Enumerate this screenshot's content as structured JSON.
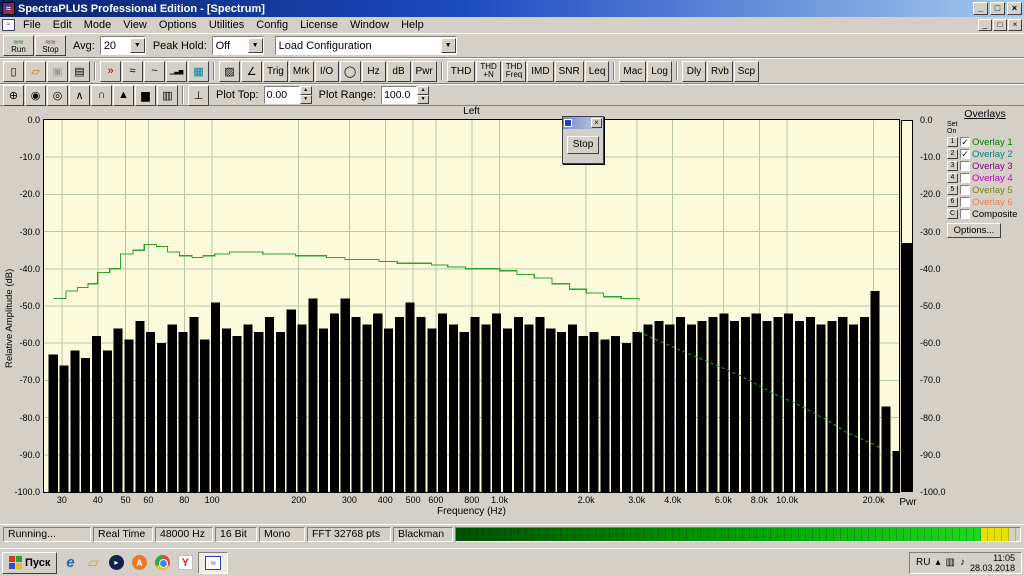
{
  "window": {
    "title": "SpectraPLUS Professional Edition - [Spectrum]",
    "minimize": "_",
    "maximize": "□",
    "close": "×"
  },
  "menu": {
    "items": [
      "File",
      "Edit",
      "Mode",
      "View",
      "Options",
      "Utilities",
      "Config",
      "License",
      "Window",
      "Help"
    ]
  },
  "toolbar1": {
    "run_label": "Run",
    "stop_label": "Stop",
    "avg_label": "Avg:",
    "avg_value": "20",
    "peak_label": "Peak Hold:",
    "peak_value": "Off",
    "config_value": "Load Configuration"
  },
  "toolbar2": {
    "items": [
      {
        "type": "icon",
        "name": "new-file",
        "glyph": "▯"
      },
      {
        "type": "icon",
        "name": "open-folder",
        "glyph": "▱",
        "color": "#b08000"
      },
      {
        "type": "icon",
        "name": "save",
        "glyph": "▣",
        "disabled": true
      },
      {
        "type": "icon",
        "name": "print",
        "glyph": "▤"
      },
      {
        "type": "sep"
      },
      {
        "type": "icon",
        "name": "fast-forward",
        "glyph": "»",
        "color": "#a00000"
      },
      {
        "type": "icon",
        "name": "time-series",
        "glyph": "≈"
      },
      {
        "type": "icon",
        "name": "waveform",
        "glyph": "~"
      },
      {
        "type": "icon",
        "name": "spectrum-bars",
        "glyph": "▁▃▅"
      },
      {
        "type": "icon",
        "name": "spectrogram",
        "glyph": "▦",
        "color": "#0080a0"
      },
      {
        "type": "sep"
      },
      {
        "type": "icon",
        "name": "surface-plot",
        "glyph": "▨"
      },
      {
        "type": "icon",
        "name": "phase",
        "glyph": "∠"
      },
      {
        "type": "text",
        "name": "trigger",
        "label": "Trig"
      },
      {
        "type": "text",
        "name": "markers",
        "label": "Mrk"
      },
      {
        "type": "text",
        "name": "io",
        "label": "I/O"
      },
      {
        "type": "icon",
        "name": "clock",
        "glyph": "◯"
      },
      {
        "type": "text",
        "name": "hz",
        "label": "Hz"
      },
      {
        "type": "text",
        "name": "db",
        "label": "dB"
      },
      {
        "type": "text",
        "name": "pwr",
        "label": "Pwr"
      },
      {
        "type": "sep"
      },
      {
        "type": "text",
        "name": "thd",
        "label": "THD"
      },
      {
        "type": "text",
        "name": "thd-n",
        "label": "THD\n+N",
        "small": true
      },
      {
        "type": "text",
        "name": "thd-freq",
        "label": "THD\nFreq",
        "small": true
      },
      {
        "type": "text",
        "name": "imd",
        "label": "IMD"
      },
      {
        "type": "text",
        "name": "snr",
        "label": "SNR"
      },
      {
        "type": "text",
        "name": "leq",
        "label": "Leq"
      },
      {
        "type": "sep"
      },
      {
        "type": "text",
        "name": "mac",
        "label": "Mac"
      },
      {
        "type": "text",
        "name": "log",
        "label": "Log"
      },
      {
        "type": "sep"
      },
      {
        "type": "text",
        "name": "dly",
        "label": "Dly"
      },
      {
        "type": "text",
        "name": "rvb",
        "label": "Rvb"
      },
      {
        "type": "text",
        "name": "scp",
        "label": "Scp"
      }
    ]
  },
  "toolbar3": {
    "items": [
      {
        "type": "icon",
        "name": "zoom",
        "glyph": "⊕"
      },
      {
        "type": "icon",
        "name": "cursor-toggle",
        "glyph": "◉"
      },
      {
        "type": "icon",
        "name": "readout-toggle",
        "glyph": "◎"
      },
      {
        "type": "icon",
        "name": "peak-display",
        "glyph": "∧"
      },
      {
        "type": "icon",
        "name": "line-plot",
        "glyph": "∩"
      },
      {
        "type": "icon",
        "name": "filled-plot",
        "glyph": "▲"
      },
      {
        "type": "icon",
        "name": "bar-plot",
        "glyph": "▆"
      },
      {
        "type": "icon",
        "name": "grid-table",
        "glyph": "▥"
      },
      {
        "type": "sep"
      },
      {
        "type": "icon",
        "name": "marker-line",
        "glyph": "⊥"
      }
    ],
    "plot_top_label": "Plot Top:",
    "plot_top_value": "0.00",
    "plot_range_label": "Plot Range:",
    "plot_range_value": "100.0"
  },
  "chart_data": {
    "type": "bar",
    "title": "Left",
    "xlabel": "Frequency (Hz)",
    "ylabel": "Relative Amplitude (dB)",
    "x_scale": "log",
    "xlim": [
      26,
      24500
    ],
    "ylim": [
      -100,
      0
    ],
    "grid": true,
    "background": "#fbfbdc",
    "grid_color": "#b9c6a4",
    "bar_color": "#000000",
    "x_ticks": [
      [
        30,
        "30"
      ],
      [
        40,
        "40"
      ],
      [
        50,
        "50"
      ],
      [
        60,
        "60"
      ],
      [
        80,
        "80"
      ],
      [
        100,
        "100"
      ],
      [
        200,
        "200"
      ],
      [
        300,
        "300"
      ],
      [
        400,
        "400"
      ],
      [
        500,
        "500"
      ],
      [
        600,
        "600"
      ],
      [
        800,
        "800"
      ],
      [
        1000,
        "1.0k"
      ],
      [
        2000,
        "2.0k"
      ],
      [
        3000,
        "3.0k"
      ],
      [
        4000,
        "4.0k"
      ],
      [
        6000,
        "6.0k"
      ],
      [
        8000,
        "8.0k"
      ],
      [
        10000,
        "10.0k"
      ],
      [
        20000,
        "20.0k"
      ]
    ],
    "y_ticks": [
      [
        0,
        "0.0"
      ],
      [
        -10,
        "-10.0"
      ],
      [
        -20,
        "-20.0"
      ],
      [
        -30,
        "-30.0"
      ],
      [
        -40,
        "-40.0"
      ],
      [
        -50,
        "-50.0"
      ],
      [
        -60,
        "-60.0"
      ],
      [
        -70,
        "-70.0"
      ],
      [
        -80,
        "-80.0"
      ],
      [
        -90,
        "-90.0"
      ],
      [
        -100,
        "-100.0"
      ]
    ],
    "bars": [
      [
        28,
        -63
      ],
      [
        30.5,
        -66
      ],
      [
        33.3,
        -62
      ],
      [
        36.3,
        -64
      ],
      [
        39.6,
        -58
      ],
      [
        43.2,
        -62
      ],
      [
        47.1,
        -56
      ],
      [
        51.4,
        -59
      ],
      [
        56,
        -54
      ],
      [
        61.1,
        -57
      ],
      [
        66.6,
        -60
      ],
      [
        72.6,
        -55
      ],
      [
        79.2,
        -57
      ],
      [
        86.4,
        -53
      ],
      [
        94.2,
        -59
      ],
      [
        102.7,
        -49
      ],
      [
        112,
        -56
      ],
      [
        122.1,
        -58
      ],
      [
        133.2,
        -55
      ],
      [
        145.2,
        -57
      ],
      [
        158.4,
        -53
      ],
      [
        172.7,
        -57
      ],
      [
        188.3,
        -51
      ],
      [
        205.4,
        -55
      ],
      [
        224,
        -48
      ],
      [
        244.2,
        -56
      ],
      [
        266.3,
        -52
      ],
      [
        290.4,
        -48
      ],
      [
        316.7,
        -53
      ],
      [
        345.4,
        -55
      ],
      [
        376.6,
        -52
      ],
      [
        410.7,
        -56
      ],
      [
        447.9,
        -53
      ],
      [
        488.4,
        -49
      ],
      [
        532.6,
        -53
      ],
      [
        580.8,
        -56
      ],
      [
        633.3,
        -52
      ],
      [
        690.6,
        -55
      ],
      [
        753.1,
        -57
      ],
      [
        821.2,
        -53
      ],
      [
        895.5,
        -55
      ],
      [
        976.5,
        -52
      ],
      [
        1065,
        -56
      ],
      [
        1161,
        -53
      ],
      [
        1266,
        -55
      ],
      [
        1381,
        -53
      ],
      [
        1506,
        -56
      ],
      [
        1642,
        -57
      ],
      [
        1791,
        -55
      ],
      [
        1953,
        -58
      ],
      [
        2130,
        -57
      ],
      [
        2322,
        -59
      ],
      [
        2532,
        -58
      ],
      [
        2761,
        -60
      ],
      [
        3011,
        -57
      ],
      [
        3284,
        -55
      ],
      [
        3581,
        -54
      ],
      [
        3905,
        -55
      ],
      [
        4258,
        -53
      ],
      [
        4644,
        -55
      ],
      [
        5064,
        -54
      ],
      [
        5522,
        -53
      ],
      [
        6022,
        -52
      ],
      [
        6567,
        -54
      ],
      [
        7161,
        -53
      ],
      [
        7809,
        -52
      ],
      [
        8516,
        -54
      ],
      [
        9286,
        -53
      ],
      [
        10126,
        -52
      ],
      [
        11042,
        -54
      ],
      [
        12041,
        -53
      ],
      [
        13130,
        -55
      ],
      [
        14318,
        -54
      ],
      [
        15613,
        -53
      ],
      [
        17026,
        -55
      ],
      [
        18565,
        -53
      ],
      [
        20245,
        -46
      ],
      [
        22077,
        -77
      ],
      [
        24076,
        -89
      ]
    ],
    "series": [
      {
        "name": "Overlay 1",
        "color": "#2da02d",
        "style": "solid",
        "step": true,
        "points": [
          [
            28,
            -48
          ],
          [
            31,
            -46
          ],
          [
            34,
            -45
          ],
          [
            37,
            -44
          ],
          [
            40,
            -41
          ],
          [
            44,
            -40
          ],
          [
            48,
            -36
          ],
          [
            53,
            -35
          ],
          [
            58,
            -33.5
          ],
          [
            64,
            -34
          ],
          [
            70,
            -35.5
          ],
          [
            77,
            -36.5
          ],
          [
            85,
            -37
          ],
          [
            93,
            -36.5
          ],
          [
            102,
            -36
          ],
          [
            115,
            -35.5
          ],
          [
            130,
            -35.5
          ],
          [
            150,
            -36
          ],
          [
            170,
            -36
          ],
          [
            195,
            -36.5
          ],
          [
            220,
            -36.5
          ],
          [
            250,
            -37
          ],
          [
            290,
            -37.5
          ],
          [
            330,
            -37.5
          ],
          [
            380,
            -38
          ],
          [
            440,
            -38.5
          ],
          [
            500,
            -38.5
          ],
          [
            580,
            -39
          ],
          [
            660,
            -39.5
          ],
          [
            760,
            -40
          ],
          [
            870,
            -40
          ],
          [
            1000,
            -40.5
          ],
          [
            1150,
            -41.5
          ],
          [
            1320,
            -42.5
          ],
          [
            1520,
            -44
          ],
          [
            1750,
            -45.5
          ],
          [
            2000,
            -46.5
          ],
          [
            2300,
            -47.5
          ],
          [
            2650,
            -48
          ],
          [
            3050,
            -48.5
          ]
        ]
      },
      {
        "name": "Overlay 2",
        "color": "#2d8a2d",
        "style": "dashed",
        "step": false,
        "points": [
          [
            3050,
            -57
          ],
          [
            3500,
            -59
          ],
          [
            4000,
            -61
          ],
          [
            4600,
            -63
          ],
          [
            5300,
            -65
          ],
          [
            6100,
            -67
          ],
          [
            7000,
            -69
          ],
          [
            8000,
            -71.5
          ],
          [
            9200,
            -74
          ],
          [
            10600,
            -76
          ],
          [
            12200,
            -78.5
          ],
          [
            14000,
            -81
          ],
          [
            16100,
            -84
          ],
          [
            18500,
            -86
          ],
          [
            21000,
            -88
          ]
        ]
      }
    ]
  },
  "pwr": {
    "label": "Pwr",
    "level_db": -33
  },
  "overlays": {
    "title": "Overlays",
    "col_set": "Set",
    "col_on": "On",
    "rows": [
      {
        "num": "1",
        "checked": true,
        "label": "Overlay 1",
        "color": "#008000"
      },
      {
        "num": "2",
        "checked": true,
        "label": "Overlay 2",
        "color": "#008080"
      },
      {
        "num": "3",
        "checked": false,
        "label": "Overlay 3",
        "color": "#800080"
      },
      {
        "num": "4",
        "checked": false,
        "label": "Overlay 4",
        "color": "#c000c0"
      },
      {
        "num": "5",
        "checked": false,
        "label": "Overlay 5",
        "color": "#808000"
      },
      {
        "num": "6",
        "checked": false,
        "label": "Overlay 6",
        "color": "#f08050"
      },
      {
        "num": "C",
        "checked": false,
        "label": "Composite",
        "color": "#000000"
      }
    ],
    "options_label": "Options..."
  },
  "stop_dialog": {
    "button_label": "Stop",
    "close_glyph": "×"
  },
  "statusbar": {
    "items": [
      "Running...",
      "Real Time",
      "48000 Hz",
      "16 Bit",
      "Mono",
      "FFT 32768 pts",
      "Blackman"
    ],
    "progress_pct": 93
  },
  "taskbar": {
    "start_label": "Пуск",
    "lang": "RU",
    "time": "11:05",
    "date": "28.03.2018",
    "quick_launch": [
      "internet-explorer",
      "folder",
      "media-player",
      "amigo-browser",
      "chrome",
      "yandex-browser"
    ]
  }
}
